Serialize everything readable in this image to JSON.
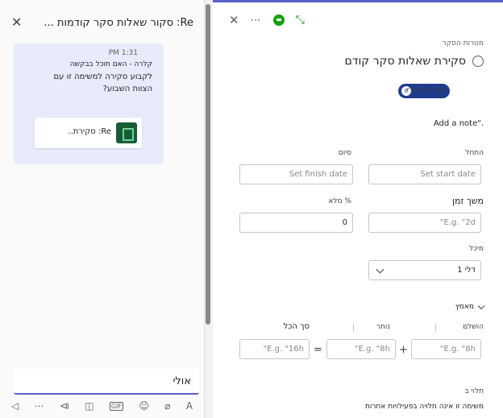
{
  "chat": {
    "title": "Re: סקור שאלות סקר קודמות ...",
    "message": {
      "time": "1:31 PM",
      "sender": "קלרה - האם תוכל בבקשה",
      "body": "לקבוע סקירה למשימה זו עם הצוות השבוע?"
    },
    "attachment_label": "Re: סקירת..",
    "compose_value": "אולי",
    "icons": {
      "close": "close-icon",
      "send": "send-icon",
      "more": "more-icon",
      "format": "format-icon",
      "attach": "attach-icon",
      "emoji": "emoji-icon",
      "gif": "gif-icon",
      "sticker": "sticker-icon",
      "meet": "meet-icon"
    }
  },
  "task": {
    "section_label": "מטרות הסקר",
    "name": "סקירת שאלות סקר קודם",
    "assignee_initial": "8",
    "assignee_name": "קלרה ברוידי",
    "add_note": "Add a note\".",
    "start_label": "התחל",
    "start_placeholder": "Set start date",
    "finish_label": "סיום",
    "finish_placeholder": "Set finish date",
    "duration_label": "משך זמן",
    "duration_placeholder": "E.g. \"2d\"",
    "percent_label": "% מלא",
    "percent_value": "0",
    "bucket_label": "מיכל",
    "bucket_value": "דלי 1",
    "effort_label": "מאמץ",
    "completed_label": "הושלם",
    "remaining_label": "נותר",
    "total_label": "סך הכל",
    "completed_placeholder": "E.g. \"8h\"",
    "remaining_placeholder": "E.g. \"8h\"",
    "total_placeholder": "E.g. \"16h\"",
    "plus": "+",
    "equals": "=",
    "dependencies_label": "תלוי ב",
    "dependencies_text": "משימה זו אינה תלויה בפעילויות אחרות"
  },
  "colors": {
    "accent": "#5b5fc7",
    "chat_bubble": "#e8ebfa",
    "assignee": "#1f3b8c",
    "planner_green": "#13a10e"
  }
}
